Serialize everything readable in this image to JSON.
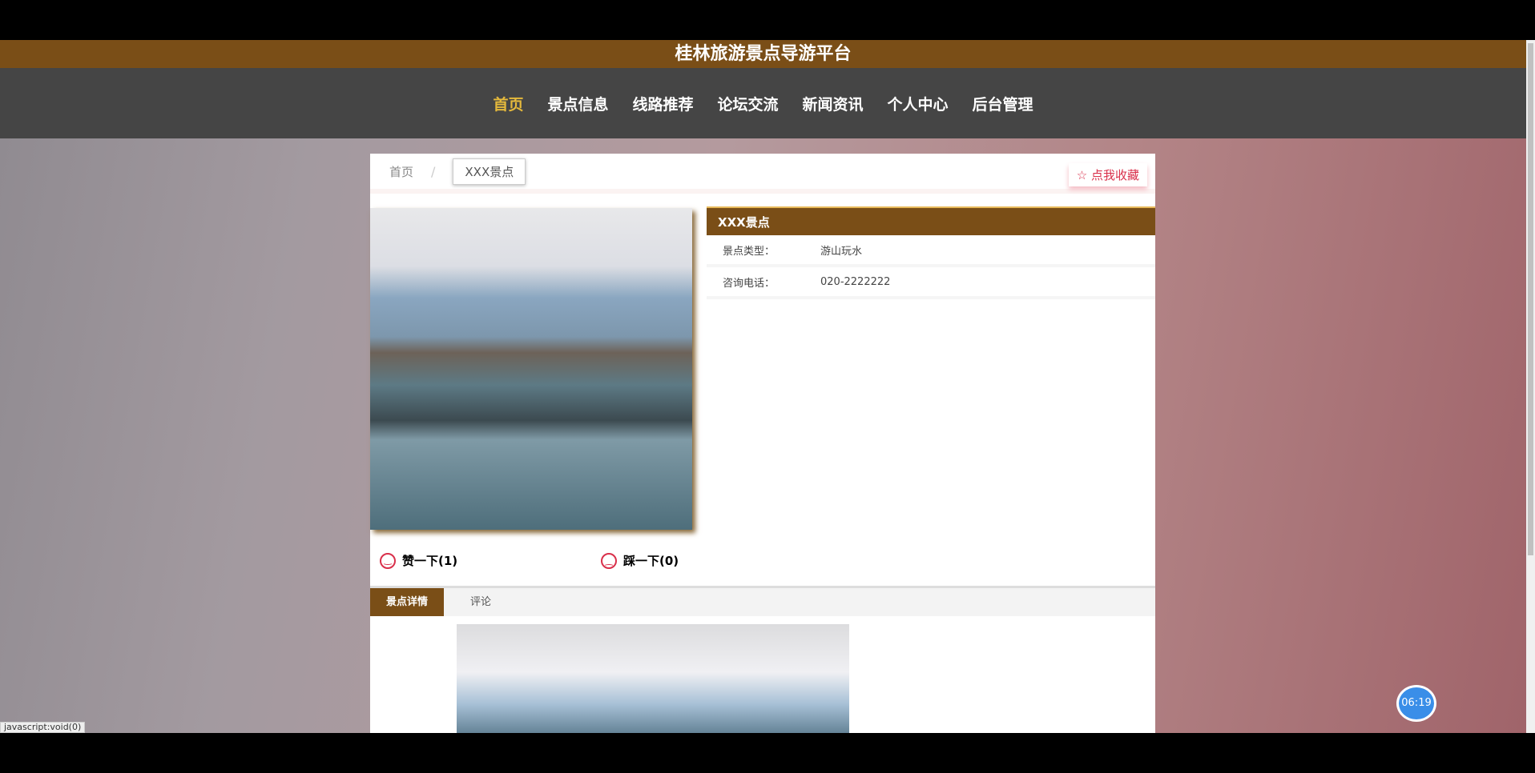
{
  "site_title": "桂林旅游景点导游平台",
  "nav": [
    "首页",
    "景点信息",
    "线路推荐",
    "论坛交流",
    "新闻资讯",
    "个人中心",
    "后台管理"
  ],
  "breadcrumb": {
    "home": "首页",
    "separator": "/",
    "current": "XXX景点"
  },
  "favorite_label": "☆ 点我收藏",
  "info": {
    "title": "XXX景点",
    "rows": [
      {
        "k": "景点类型：",
        "v": "游山玩水"
      },
      {
        "k": "咨询电话：",
        "v": "020-2222222"
      }
    ]
  },
  "votes": {
    "like": "赞一下(1)",
    "dislike": "踩一下(0)"
  },
  "tabs": [
    "景点详情",
    "评论"
  ],
  "status_text": "javascript:void(0)",
  "timer": "06:19"
}
